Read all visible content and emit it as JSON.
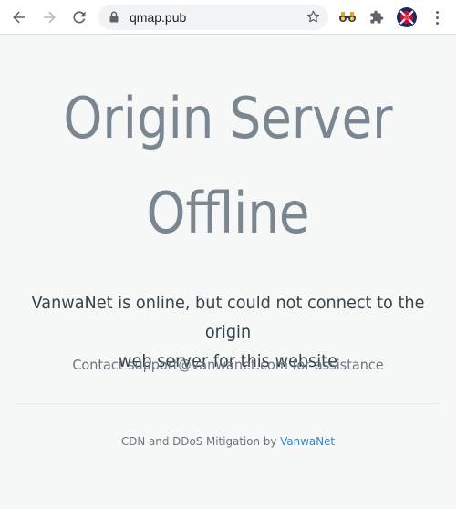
{
  "browser": {
    "url": "qmap.pub",
    "icons": {
      "back": "arrow-left-icon",
      "forward": "arrow-right-icon",
      "reload": "reload-icon",
      "lock": "lock-icon",
      "bookmark": "star-icon",
      "extension_1": "binoculars-icon",
      "extensions": "puzzle-piece-icon",
      "profile": "avatar",
      "menu": "three-dots-menu-icon"
    }
  },
  "page": {
    "headline_line1": "Origin Server",
    "headline_line2": "Offline",
    "message_line1": "VanwaNet is online, but could not connect to the origin",
    "message_line2": "web server for this website",
    "contact": "Contact support@vanwanet.com for assistance",
    "footer_prefix": "CDN and DDoS Mitigation by",
    "footer_link": "VanwaNet"
  },
  "colors": {
    "background": "#f6f8f8",
    "headline": "#7a8790",
    "message": "#36434d",
    "muted": "#6c757d",
    "link": "#2f86d6"
  }
}
